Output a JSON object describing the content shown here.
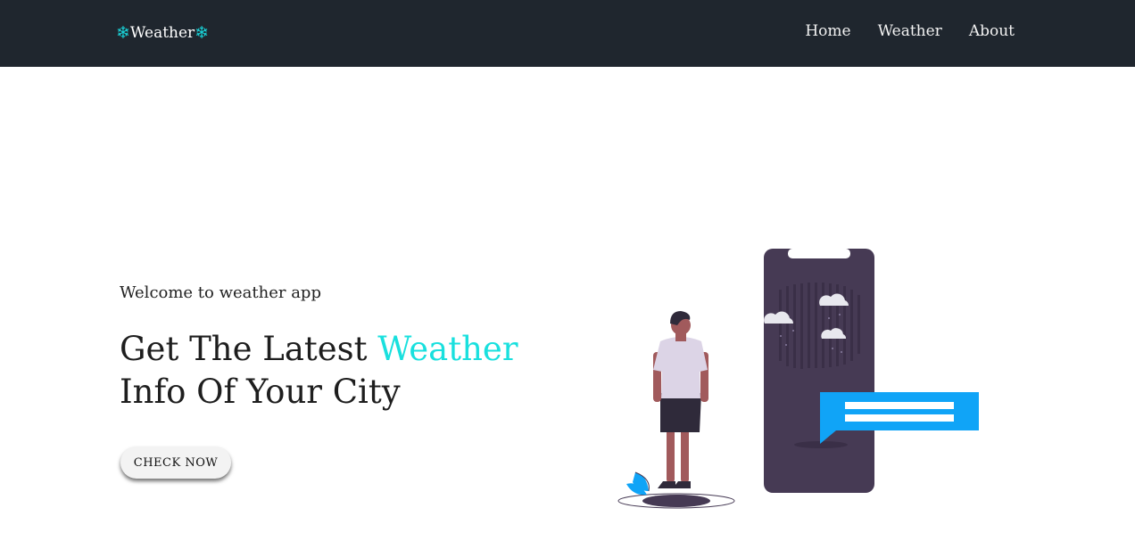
{
  "navbar": {
    "brand": {
      "icon_left": "snowflake-icon",
      "icon_right": "snowflake-icon",
      "text": "Weather",
      "accent_color": "#19d3d8"
    },
    "links": [
      {
        "label": "Home"
      },
      {
        "label": "Weather"
      },
      {
        "label": "About"
      }
    ],
    "background": "#1f262e"
  },
  "hero": {
    "subtitle": "Welcome to weather app",
    "title_part1": "Get The Latest ",
    "title_accent": "Weather",
    "title_part2": "Info Of Your City",
    "accent_color": "#19e0de",
    "cta_label": "CHECK NOW"
  },
  "illustration": {
    "name": "man-with-phone-weather-illustration",
    "colors": {
      "phone": "#463a54",
      "bubble": "#10a4f7",
      "shirt": "#dcd4e6",
      "skin": "#a15a5c"
    }
  }
}
